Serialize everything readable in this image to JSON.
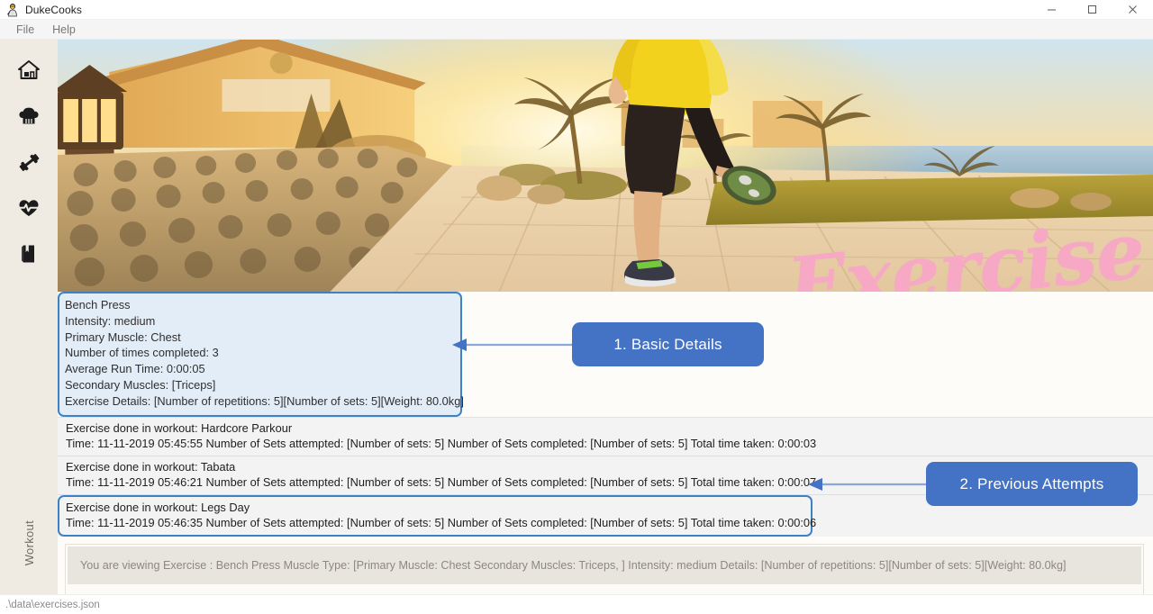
{
  "window": {
    "title": "DukeCooks",
    "icon": "duke-mascot-icon",
    "controls": {
      "minimize": "minimize-icon",
      "maximize": "maximize-icon",
      "close": "close-icon"
    }
  },
  "menubar": {
    "items": [
      {
        "label": "File",
        "name": "menu-file"
      },
      {
        "label": "Help",
        "name": "menu-help"
      }
    ]
  },
  "sidebar": {
    "items": [
      {
        "icon": "home-icon",
        "name": "sidebar-item-dashboard"
      },
      {
        "icon": "chef-hat-icon",
        "name": "sidebar-item-recipes"
      },
      {
        "icon": "dumbbell-icon",
        "name": "sidebar-item-workout"
      },
      {
        "icon": "heart-pulse-icon",
        "name": "sidebar-item-health"
      },
      {
        "icon": "diary-book-icon",
        "name": "sidebar-item-diary"
      }
    ],
    "vertical_label": "Workout"
  },
  "hero": {
    "banner_word": "Exercise"
  },
  "detail": {
    "lines": [
      "Bench Press",
      "Intensity: medium",
      "Primary Muscle: Chest",
      "Number of times completed: 3",
      "Average Run Time: 0:00:05",
      "Secondary Muscles: [Triceps]",
      "Exercise Details: [Number of repetitions: 5][Number of sets: 5][Weight: 80.0kg]"
    ]
  },
  "attempts": [
    {
      "title": "Exercise done in workout: Hardcore Parkour",
      "detail": "Time: 11-11-2019 05:45:55   Number of Sets attempted: [Number of sets: 5]   Number of Sets completed: [Number of sets: 5]   Total time taken: 0:00:03",
      "highlighted": false
    },
    {
      "title": "Exercise done in workout: Tabata",
      "detail": "Time: 11-11-2019 05:46:21   Number of Sets attempted: [Number of sets: 5]   Number of Sets completed: [Number of sets: 5]   Total time taken: 0:00:07",
      "highlighted": false
    },
    {
      "title": "Exercise done in workout: Legs Day",
      "detail": "Time: 11-11-2019 05:46:35   Number of Sets attempted: [Number of sets: 5]   Number of Sets completed: [Number of sets: 5]   Total time taken: 0:00:06",
      "highlighted": true
    }
  ],
  "result": {
    "text": "You are viewing Exercise : Bench Press Muscle Type:  [Primary Muscle: Chest Secondary Muscles: Triceps, ] Intensity: medium Details: [Number of repetitions: 5][Number of sets: 5][Weight: 80.0kg]"
  },
  "statusbar": {
    "path": ".\\data\\exercises.json"
  },
  "annotations": [
    {
      "label": "1. Basic Details",
      "name": "annotation-basic-details"
    },
    {
      "label": "2. Previous Attempts",
      "name": "annotation-previous-attempts"
    }
  ],
  "colors": {
    "accent_blue": "#4472c4",
    "selection_border": "#3c82c4",
    "rail_bg": "#efebe3",
    "banner_pink": "#f6a8c4"
  }
}
